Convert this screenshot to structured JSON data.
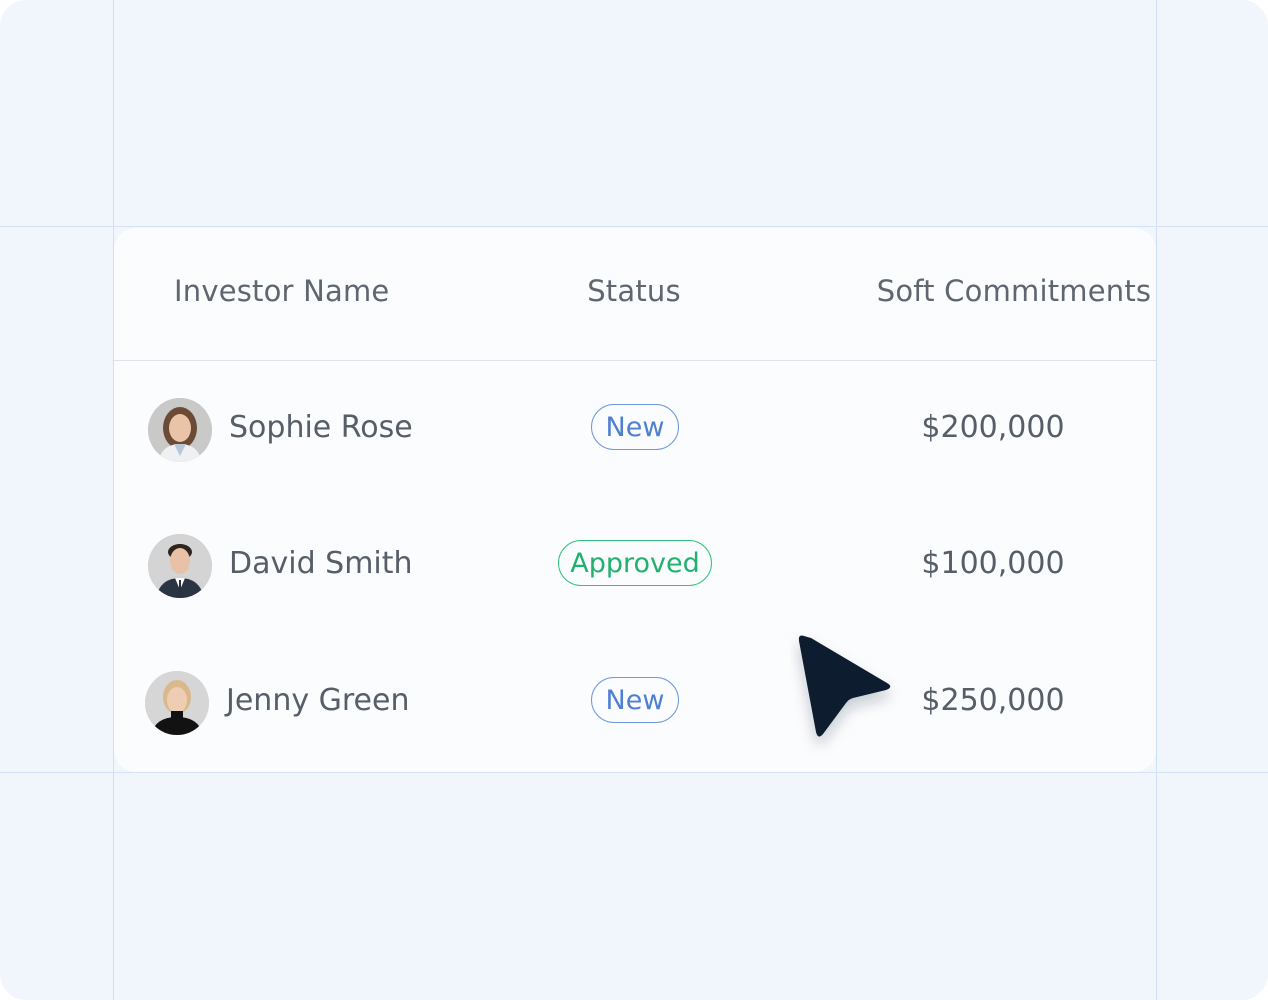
{
  "table": {
    "columns": {
      "name": "Investor Name",
      "status": "Status",
      "soft": "Soft Commitments"
    },
    "rows": [
      {
        "name": "Sophie Rose",
        "status": "New",
        "status_color": "#4f7fd3",
        "amount": "$200,000"
      },
      {
        "name": "David Smith",
        "status": "Approved",
        "status_color": "#22b16d",
        "amount": "$100,000"
      },
      {
        "name": "Jenny Green",
        "status": "New",
        "status_color": "#4f7fd3",
        "amount": "$250,000"
      }
    ]
  },
  "icons": {
    "cursor": "pointer-cursor-icon"
  },
  "colors": {
    "background": "#f1f6fd",
    "card": "#fbfcfe",
    "guide_lines": "#cfe0f6",
    "text": "#565e68",
    "cursor": "#0f1b2d"
  }
}
